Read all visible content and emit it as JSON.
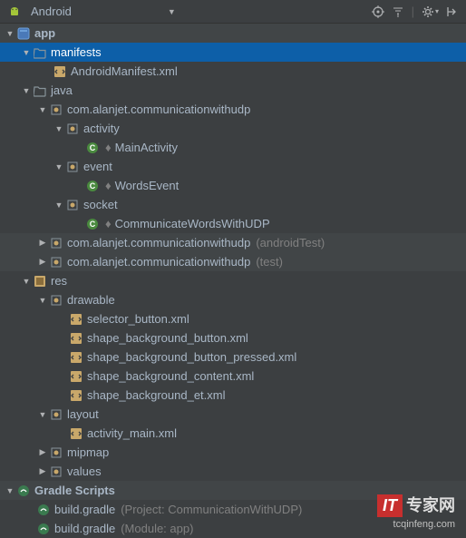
{
  "toolbar": {
    "view_label": "Android"
  },
  "tree": {
    "app": {
      "label": "app"
    },
    "manifests": {
      "label": "manifests"
    },
    "android_manifest": {
      "label": "AndroidManifest.xml"
    },
    "java": {
      "label": "java"
    },
    "pkg_main": {
      "label": "com.alanjet.communicationwithudp"
    },
    "pkg_activity": {
      "label": "activity"
    },
    "main_activity": {
      "label": "MainActivity"
    },
    "pkg_event": {
      "label": "event"
    },
    "words_event": {
      "label": "WordsEvent"
    },
    "pkg_socket": {
      "label": "socket"
    },
    "communicate": {
      "label": "CommunicateWordsWithUDP"
    },
    "pkg_android_test": {
      "label": "com.alanjet.communicationwithudp",
      "suffix": "(androidTest)"
    },
    "pkg_test": {
      "label": "com.alanjet.communicationwithudp",
      "suffix": "(test)"
    },
    "res": {
      "label": "res"
    },
    "drawable": {
      "label": "drawable"
    },
    "selector_button": {
      "label": "selector_button.xml"
    },
    "shape_bg_button": {
      "label": "shape_background_button.xml"
    },
    "shape_bg_button_pressed": {
      "label": "shape_background_button_pressed.xml"
    },
    "shape_bg_content": {
      "label": "shape_background_content.xml"
    },
    "shape_bg_et": {
      "label": "shape_background_et.xml"
    },
    "layout": {
      "label": "layout"
    },
    "activity_main_xml": {
      "label": "activity_main.xml"
    },
    "mipmap": {
      "label": "mipmap"
    },
    "values": {
      "label": "values"
    },
    "gradle_scripts": {
      "label": "Gradle Scripts"
    },
    "build_gradle_project": {
      "label": "build.gradle",
      "suffix": "(Project: CommunicationWithUDP)"
    },
    "build_gradle_module": {
      "label": "build.gradle",
      "suffix": "(Module: app)"
    }
  },
  "watermark": {
    "brand_it": "IT",
    "brand_cn": "专家网",
    "url": "tcqinfeng.com"
  }
}
